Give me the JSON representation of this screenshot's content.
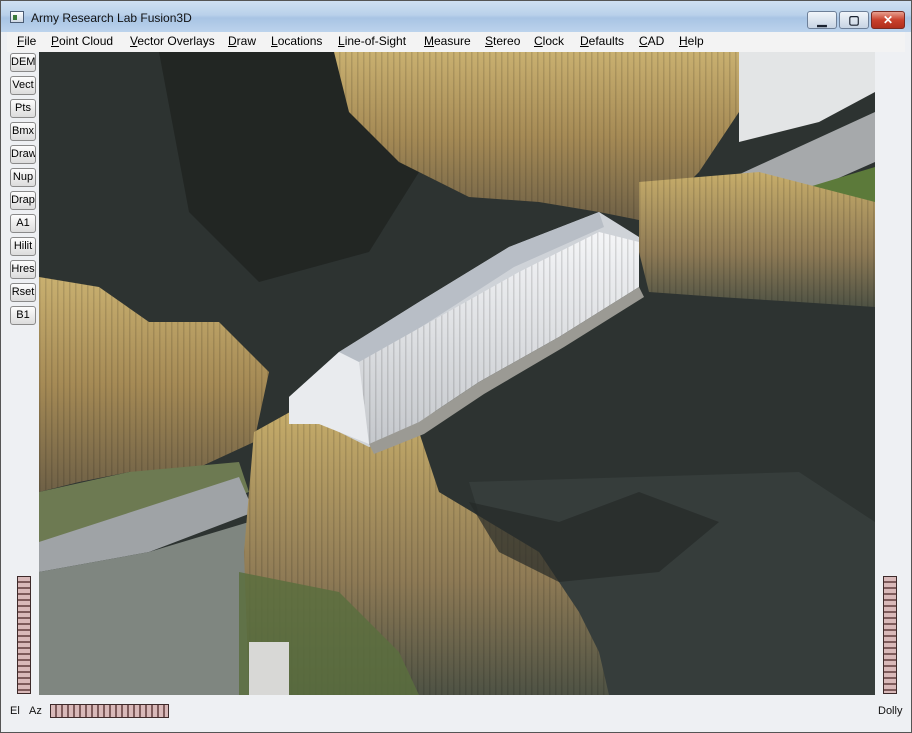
{
  "window": {
    "title": "Army Research Lab Fusion3D",
    "controls": {
      "minimize": "▁",
      "maximize": "▢",
      "close": "✕"
    }
  },
  "menu": {
    "items": [
      "File",
      "Point Cloud",
      "Vector Overlays",
      "Draw",
      "Locations",
      "Line-of-Sight",
      "Measure",
      "Stereo",
      "Clock",
      "Defaults",
      "CAD",
      "Help"
    ]
  },
  "toolbar": {
    "buttons": [
      "DEM",
      "Vect",
      "Pts",
      "Bmx",
      "Draw",
      "Nup",
      "Drap",
      "A1",
      "Hilit",
      "Hres",
      "Rset",
      "B1"
    ]
  },
  "status": {
    "el_label": "El",
    "az_label": "Az",
    "dolly_label": "Dolly"
  },
  "colors": {
    "bridge": "#e6e8ec",
    "water": "#2c3230",
    "foliage": "#b69a5c",
    "road": "#9a9c9e"
  }
}
